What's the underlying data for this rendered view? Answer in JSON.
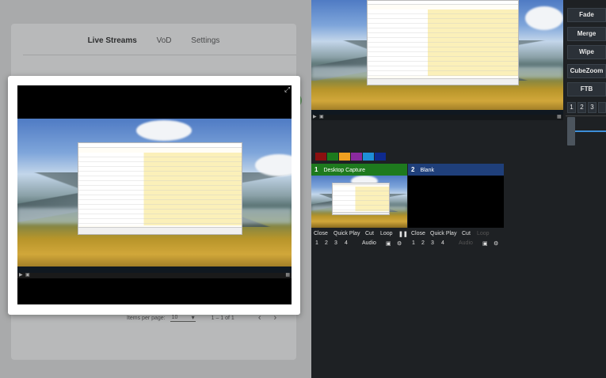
{
  "web_app": {
    "tabs": [
      {
        "label": "Live Streams",
        "active": true
      },
      {
        "label": "VoD",
        "active": false
      },
      {
        "label": "Settings",
        "active": false
      }
    ],
    "pagination": {
      "items_per_page_label": "Items per page:",
      "items_per_page_value": "10",
      "range": "1 – 1 of 1",
      "prev_icon": "chevron-left-icon",
      "next_icon": "chevron-right-icon"
    }
  },
  "switcher": {
    "transitions": [
      "Fade",
      "Merge",
      "Wipe",
      "CubeZoom",
      "FTB"
    ],
    "transition_numbers": [
      "1",
      "2",
      "3"
    ],
    "colors": [
      "#8b1010",
      "#1d7a1d",
      "#f0a020",
      "#8a2a9e",
      "#1e8fd8",
      "#0e2a8e"
    ],
    "slots": [
      {
        "number": "1",
        "name": "Desktop Capture",
        "header_color": "#1e7a1e",
        "controls": [
          "Close",
          "Quick Play",
          "Cut",
          "Loop"
        ],
        "pause_icon": "pause-icon",
        "numbers": [
          "1",
          "2",
          "3",
          "4"
        ],
        "audio_label": "Audio",
        "loop_enabled": true
      },
      {
        "number": "2",
        "name": "Blank",
        "header_color": "#1f3f7a",
        "controls": [
          "Close",
          "Quick Play",
          "Cut",
          "Loop"
        ],
        "numbers": [
          "1",
          "2",
          "3",
          "4"
        ],
        "audio_label": "Audio",
        "loop_enabled": false
      }
    ]
  }
}
